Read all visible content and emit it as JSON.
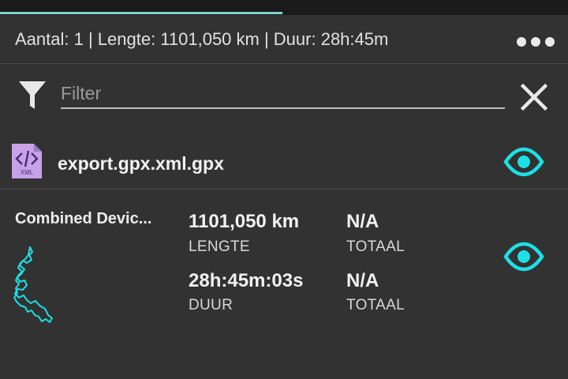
{
  "progress": {
    "fraction": 0.497
  },
  "summary": {
    "text": "Aantal: 1 | Lengte: 1101,050 km | Duur: 28h:45m",
    "more_icon": "more-dots-icon"
  },
  "filter": {
    "placeholder": "Filter",
    "value": "",
    "filter_icon": "funnel-icon",
    "clear_icon": "close-icon"
  },
  "file": {
    "name": "export.gpx.xml.gpx",
    "icon": "xml-file-icon",
    "icon_caption": "XML",
    "visibility_icon": "eye-icon"
  },
  "track": {
    "name": "Combined Devic...",
    "thumbnail_icon": "track-route-thumbnail",
    "stats": [
      {
        "value": "1101,050 km",
        "label": "LENGTE"
      },
      {
        "value": "N/A",
        "label": "TOTAAL"
      },
      {
        "value": "28h:45m:03s",
        "label": "DUUR"
      },
      {
        "value": "N/A",
        "label": "TOTAAL"
      }
    ],
    "visibility_icon": "eye-icon"
  },
  "colors": {
    "background": "#323232",
    "top_strip": "#1b1b1b",
    "progress": "#7fd3d3",
    "accent_cyan": "#1ce0e6",
    "file_icon_purple": "#c7a2e8"
  }
}
